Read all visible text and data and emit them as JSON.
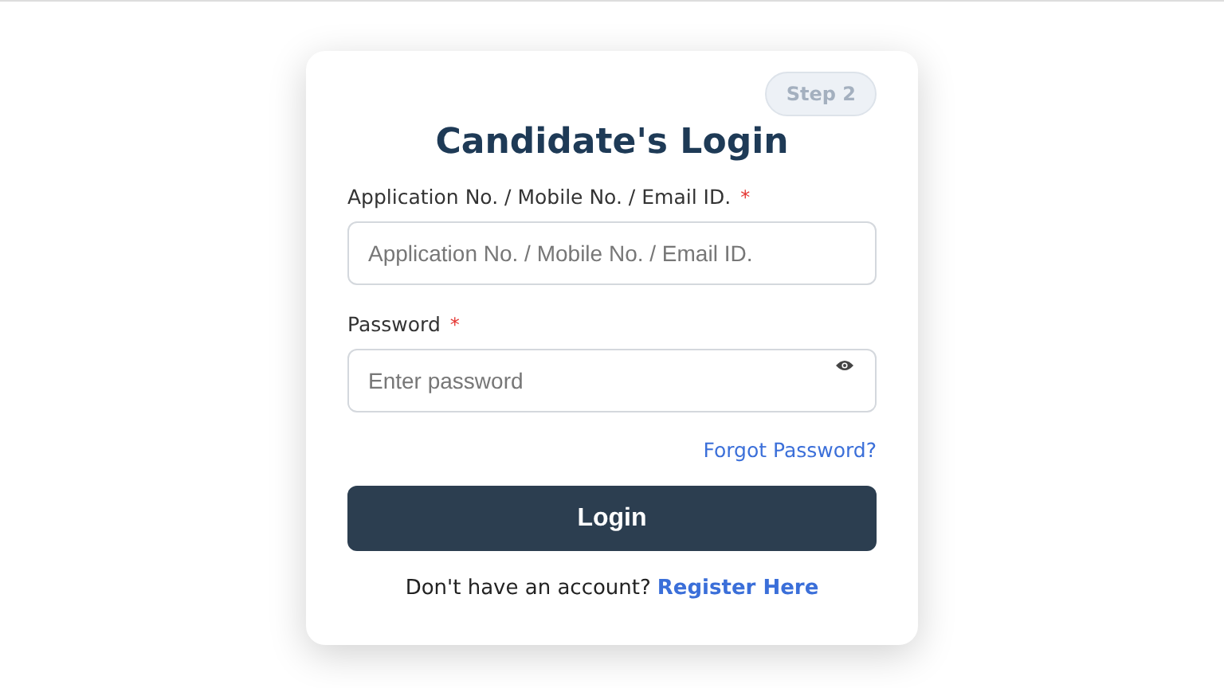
{
  "badge": "Step 2",
  "title": "Candidate's Login",
  "fields": [
    {
      "label": "Application No. / Mobile No. / Email ID.",
      "required_mark": "*",
      "placeholder": "Application No. / Mobile No. / Email ID.",
      "kind": "text"
    },
    {
      "label": "Password",
      "required_mark": "*",
      "placeholder": "Enter password",
      "kind": "password"
    }
  ],
  "forgot_link": "Forgot Password?",
  "login_button": "Login",
  "register_prompt": "Don't have an account?",
  "register_link": "Register Here"
}
